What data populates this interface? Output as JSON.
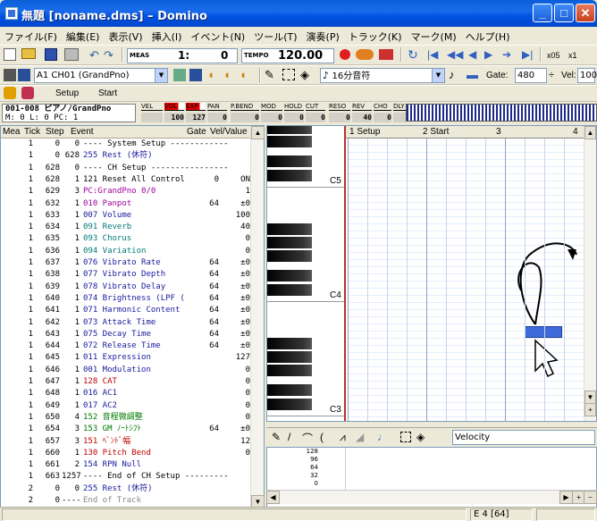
{
  "window": {
    "title": "無題 [noname.dms] – Domino"
  },
  "menu": [
    "ファイル(F)",
    "編集(E)",
    "表示(V)",
    "挿入(I)",
    "イベント(N)",
    "ツール(T)",
    "演奏(P)",
    "トラック(K)",
    "マーク(M)",
    "ヘルプ(H)"
  ],
  "toolbar1": {
    "meas_label": "MEAS",
    "position": "1:",
    "tick": "0",
    "tempo_label": "TEMPO",
    "tempo": "120.00",
    "zoom1": "x05",
    "zoom2": "x1"
  },
  "toolbar2": {
    "track_combo": "A1 CH01 (GrandPno)",
    "note_length": "16分音符",
    "gate_label": "Gate:",
    "gate": "480",
    "vel_label": "Vel:",
    "vel": "100"
  },
  "toolbar3": {
    "setup": "Setup",
    "start": "Start"
  },
  "track_info": {
    "line1": "001-008 ピアノ/GrandPno",
    "line2": "M:   0 L:   0 PC:   1"
  },
  "meters": {
    "labels": [
      "VEL",
      "VOL",
      "EXP",
      "PAN",
      "P.BEND",
      "MOD",
      "HOLD",
      "CUT",
      "RESO",
      "REV",
      "CHO",
      "DLY"
    ],
    "values": [
      "",
      "100",
      "127",
      "0",
      "0",
      "0",
      "0",
      "0",
      "0",
      "40",
      "0",
      ""
    ]
  },
  "event_list": {
    "headers": {
      "mea": "Mea",
      "tick": "Tick",
      "step": "Step",
      "event": "Event",
      "gate": "Gate",
      "vel": "Vel/Value"
    },
    "rows": [
      {
        "mea": "1",
        "tick": "0",
        "step": "0",
        "event": "---- System Setup ------------",
        "gate": "",
        "vel": "",
        "color": "#000"
      },
      {
        "mea": "1",
        "tick": "0",
        "step": "628",
        "event": "255 Rest (休符)",
        "gate": "",
        "vel": "",
        "color": "#1a1a9e"
      },
      {
        "mea": "1",
        "tick": "628",
        "step": "0",
        "event": "---- CH Setup ----------------",
        "gate": "",
        "vel": "",
        "color": "#000"
      },
      {
        "mea": "1",
        "tick": "628",
        "step": "1",
        "event": "121 Reset All Control",
        "gate": "0",
        "vel": "ON",
        "color": "#000"
      },
      {
        "mea": "1",
        "tick": "629",
        "step": "3",
        "event": "PC:GrandPno      0/0",
        "gate": "",
        "vel": "1",
        "color": "#a0009e"
      },
      {
        "mea": "1",
        "tick": "632",
        "step": "1",
        "event": "010 Panpot",
        "gate": "64",
        "vel": "±0",
        "color": "#a0009e"
      },
      {
        "mea": "1",
        "tick": "633",
        "step": "1",
        "event": "007 Volume",
        "gate": "",
        "vel": "100",
        "color": "#1a1a9e"
      },
      {
        "mea": "1",
        "tick": "634",
        "step": "1",
        "event": "091 Reverb",
        "gate": "",
        "vel": "40",
        "color": "#007a7a"
      },
      {
        "mea": "1",
        "tick": "635",
        "step": "1",
        "event": "093 Chorus",
        "gate": "",
        "vel": "0",
        "color": "#007a7a"
      },
      {
        "mea": "1",
        "tick": "636",
        "step": "1",
        "event": "094 Variation",
        "gate": "",
        "vel": "0",
        "color": "#007a7a"
      },
      {
        "mea": "1",
        "tick": "637",
        "step": "1",
        "event": "076 Vibrato Rate",
        "gate": "64",
        "vel": "±0",
        "color": "#1a1a9e"
      },
      {
        "mea": "1",
        "tick": "638",
        "step": "1",
        "event": "077 Vibrato Depth",
        "gate": "64",
        "vel": "±0",
        "color": "#1a1a9e"
      },
      {
        "mea": "1",
        "tick": "639",
        "step": "1",
        "event": "078 Vibrato Delay",
        "gate": "64",
        "vel": "±0",
        "color": "#1a1a9e"
      },
      {
        "mea": "1",
        "tick": "640",
        "step": "1",
        "event": "074 Brightness (LPF (",
        "gate": "64",
        "vel": "±0",
        "color": "#1a1a9e"
      },
      {
        "mea": "1",
        "tick": "641",
        "step": "1",
        "event": "071 Harmonic Content",
        "gate": "64",
        "vel": "±0",
        "color": "#1a1a9e"
      },
      {
        "mea": "1",
        "tick": "642",
        "step": "1",
        "event": "073 Attack Time",
        "gate": "64",
        "vel": "±0",
        "color": "#1a1a9e"
      },
      {
        "mea": "1",
        "tick": "643",
        "step": "1",
        "event": "075 Decay Time",
        "gate": "64",
        "vel": "±0",
        "color": "#1a1a9e"
      },
      {
        "mea": "1",
        "tick": "644",
        "step": "1",
        "event": "072 Release Time",
        "gate": "64",
        "vel": "±0",
        "color": "#1a1a9e"
      },
      {
        "mea": "1",
        "tick": "645",
        "step": "1",
        "event": "011 Expression",
        "gate": "",
        "vel": "127",
        "color": "#1a1a9e"
      },
      {
        "mea": "1",
        "tick": "646",
        "step": "1",
        "event": "001 Modulation",
        "gate": "",
        "vel": "0",
        "color": "#1a1a9e"
      },
      {
        "mea": "1",
        "tick": "647",
        "step": "1",
        "event": "128 CAT",
        "gate": "",
        "vel": "0",
        "color": "#c00000"
      },
      {
        "mea": "1",
        "tick": "648",
        "step": "1",
        "event": "016 AC1",
        "gate": "",
        "vel": "0",
        "color": "#1a1a9e"
      },
      {
        "mea": "1",
        "tick": "649",
        "step": "1",
        "event": "017 AC2",
        "gate": "",
        "vel": "0",
        "color": "#1a1a9e"
      },
      {
        "mea": "1",
        "tick": "650",
        "step": "4",
        "event": "152 音程微調整",
        "gate": "",
        "vel": "0",
        "color": "#007a00"
      },
      {
        "mea": "1",
        "tick": "654",
        "step": "3",
        "event": "153 GM ﾉｰﾄｼﾌﾄ",
        "gate": "64",
        "vel": "±0",
        "color": "#007a00"
      },
      {
        "mea": "1",
        "tick": "657",
        "step": "3",
        "event": "151 ﾍﾞﾝﾄﾞ幅",
        "gate": "",
        "vel": "12",
        "color": "#c00000"
      },
      {
        "mea": "1",
        "tick": "660",
        "step": "1",
        "event": "130 Pitch Bend",
        "gate": "",
        "vel": "0",
        "color": "#c00000"
      },
      {
        "mea": "1",
        "tick": "661",
        "step": "2",
        "event": "154 RPN Null",
        "gate": "",
        "vel": "",
        "color": "#1a1a9e"
      },
      {
        "mea": "1",
        "tick": "663",
        "step": "1257",
        "event": "---- End of CH Setup ---------",
        "gate": "",
        "vel": "",
        "color": "#000"
      },
      {
        "mea": "2",
        "tick": "0",
        "step": "0",
        "event": "255 Rest (休符)",
        "gate": "",
        "vel": "",
        "color": "#1a1a9e"
      },
      {
        "mea": "2",
        "tick": "0",
        "step": "----",
        "event": "End of Track",
        "gate": "",
        "vel": "",
        "color": "#888"
      }
    ]
  },
  "piano_roll": {
    "ruler": [
      "1 Setup",
      "2 Start",
      "3",
      "4"
    ],
    "octave_labels": [
      "C5",
      "C4",
      "C3"
    ]
  },
  "controller": {
    "selected": "Velocity",
    "scale": [
      "128",
      "96",
      "64",
      "32",
      "0"
    ]
  },
  "status": {
    "position": "E 4 [64]"
  }
}
